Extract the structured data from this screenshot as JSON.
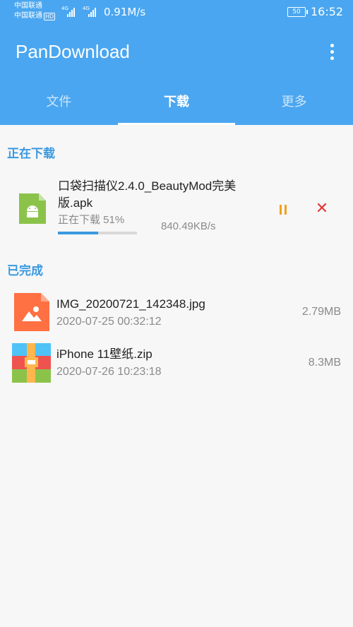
{
  "status_bar": {
    "carrier1": "中国联通",
    "carrier2": "中国联通",
    "hd": "HD",
    "net1": "4G",
    "net2": "4G",
    "speed": "0.91M/s",
    "battery": "50",
    "time": "16:52"
  },
  "app": {
    "title": "PanDownload",
    "more_icon": "more-vert-icon"
  },
  "tabs": [
    {
      "label": "文件",
      "active": false
    },
    {
      "label": "下载",
      "active": true
    },
    {
      "label": "更多",
      "active": false
    }
  ],
  "downloading": {
    "section_title": "正在下载",
    "items": [
      {
        "name": "口袋扫描仪2.4.0_BeautyMod完美版.apk",
        "status": "正在下载 51%",
        "progress": 0.51,
        "speed": "840.49KB/s",
        "icon": "android-apk-icon"
      }
    ]
  },
  "completed": {
    "section_title": "已完成",
    "items": [
      {
        "name": "IMG_20200721_142348.jpg",
        "date": "2020-07-25 00:32:12",
        "size": "2.79MB",
        "icon": "image-file-icon"
      },
      {
        "name": "iPhone 11壁纸.zip",
        "date": "2020-07-26 10:23:18",
        "size": "8.3MB",
        "icon": "zip-archive-icon"
      }
    ]
  },
  "colors": {
    "primary": "#4aa6f0",
    "accent": "#3b99e0",
    "pause": "#f0a21c",
    "cancel": "#e53935"
  }
}
